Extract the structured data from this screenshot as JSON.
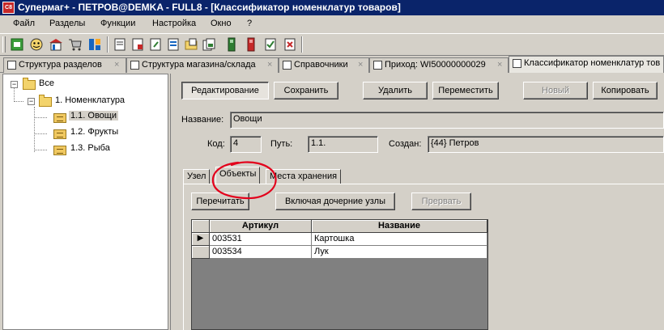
{
  "window": {
    "title": "Супермаг+ - ПЕТРОВ@DEMKA - FULL8 - [Классификатор номенклатур товаров]",
    "icon": "app-logo-icon"
  },
  "menu": [
    "Файл",
    "Разделы",
    "Функции",
    "Настройка",
    "Окно",
    "?"
  ],
  "toolbar": {
    "icons": [
      "refresh-icon",
      "face-icon",
      "store-icon",
      "cart-icon",
      "blocks-icon",
      "doc-icon",
      "doc-in-icon",
      "doc-out-icon",
      "doc-list-icon",
      "doc-folder-icon",
      "green-device-icon",
      "red-device-icon",
      "doc-check-icon",
      "doc-x-icon"
    ]
  },
  "doc_tabs": [
    {
      "label": "Структура разделов",
      "icon": "structure-icon",
      "close": "×"
    },
    {
      "label": "Структура магазина/склада",
      "icon": "cart-icon",
      "close": "×"
    },
    {
      "label": "Справочники",
      "icon": "book-icon",
      "close": "×"
    },
    {
      "label": "Приход: WI50000000029",
      "icon": "doc-icon",
      "close": "×"
    },
    {
      "label": "Классификатор номенклатур тов",
      "icon": "tree-icon",
      "active": true
    }
  ],
  "tree": {
    "root": "Все",
    "nomenclature": "1. Номенклатура",
    "items": [
      "1.1. Овощи",
      "1.2. Фрукты",
      "1.3. Рыба"
    ],
    "selected": "1.1. Овощи",
    "collapse_glyph": "−"
  },
  "actions": {
    "edit": "Редактирование",
    "save": "Сохранить",
    "delete": "Удалить",
    "move": "Переместить",
    "new": "Новый",
    "copy": "Копировать"
  },
  "form": {
    "name_label": "Название:",
    "name_value": "Овощи",
    "code_label": "Код:",
    "code_value": "4",
    "path_label": "Путь:",
    "path_value": "1.1.",
    "created_label": "Создан:",
    "created_value": "{44} Петров"
  },
  "inner_tabs": [
    "Узел",
    "Объекты",
    "Места хранения"
  ],
  "inner_active": "Объекты",
  "objects_tab": {
    "refresh": "Перечитать",
    "include_children": "Включая дочерние узлы",
    "stop": "Прервать"
  },
  "grid": {
    "columns": [
      "Артикул",
      "Название"
    ],
    "rows": [
      {
        "article": "003531",
        "name": "Картошка"
      },
      {
        "article": "003534",
        "name": "Лук"
      }
    ],
    "current_row_marker": "▶"
  },
  "colors": {
    "titlebar": "#0a246a",
    "face": "#d4d0c8",
    "annotation": "#e3001b"
  }
}
